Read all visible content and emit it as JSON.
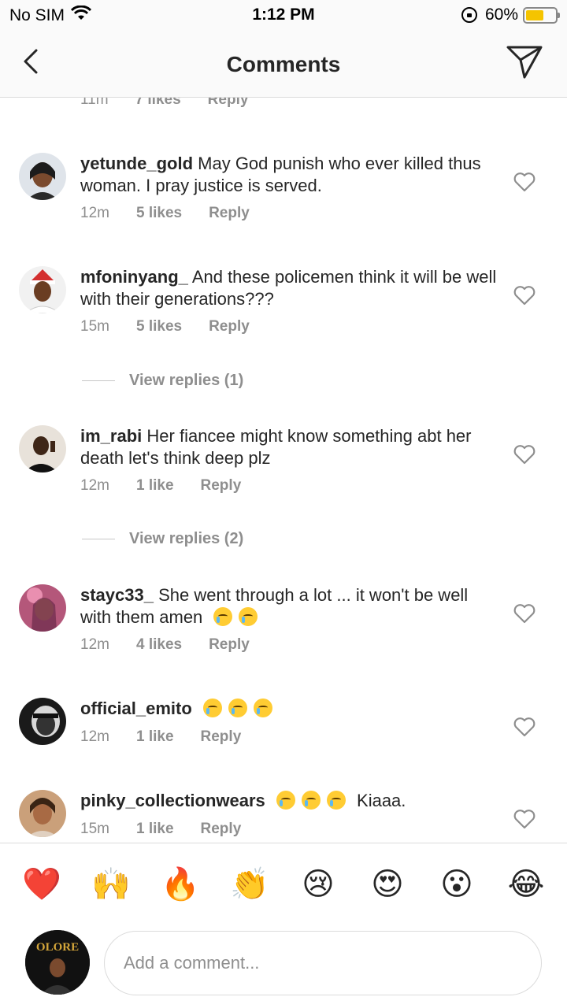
{
  "status_bar": {
    "carrier": "No SIM",
    "time": "1:12 PM",
    "battery": "60%",
    "battery_level": 0.6
  },
  "header": {
    "title": "Comments",
    "back_icon": "chevron-left-icon",
    "send_icon": "paper-plane-icon"
  },
  "partial_comment": {
    "time": "11m",
    "likes": "7 likes",
    "reply": "Reply"
  },
  "comments": [
    {
      "user": "yetunde_gold",
      "text": "May God punish who ever killed thus woman. I pray justice is served.",
      "time": "12m",
      "likes": "5 likes",
      "reply": "Reply"
    },
    {
      "user": "mfoninyang_",
      "text": "And these policemen think it will be well with their generations???",
      "time": "15m",
      "likes": "5 likes",
      "reply": "Reply",
      "view_replies": "View replies (1)"
    },
    {
      "user": "im_rabi",
      "text": "Her fiancee might know something abt her death let's think deep plz",
      "time": "12m",
      "likes": "1 like",
      "reply": "Reply",
      "view_replies": "View replies (2)"
    },
    {
      "user": "stayc33_",
      "text": "She went through a lot ... it won't be well with them amen",
      "time": "12m",
      "likes": "4 likes",
      "reply": "Reply"
    },
    {
      "user": "official_emito",
      "text": "",
      "time": "12m",
      "likes": "1 like",
      "reply": "Reply"
    },
    {
      "user": "pinky_collectionwears",
      "text": "Kiaaa.",
      "time": "15m",
      "likes": "1 like",
      "reply": "Reply"
    }
  ],
  "emoji_bar": [
    "❤️",
    "🙌",
    "🔥",
    "👏",
    "😢",
    "😍",
    "😮",
    "😂"
  ],
  "comment_input": {
    "placeholder": "Add a comment..."
  },
  "my_avatar_text": "OLORE"
}
